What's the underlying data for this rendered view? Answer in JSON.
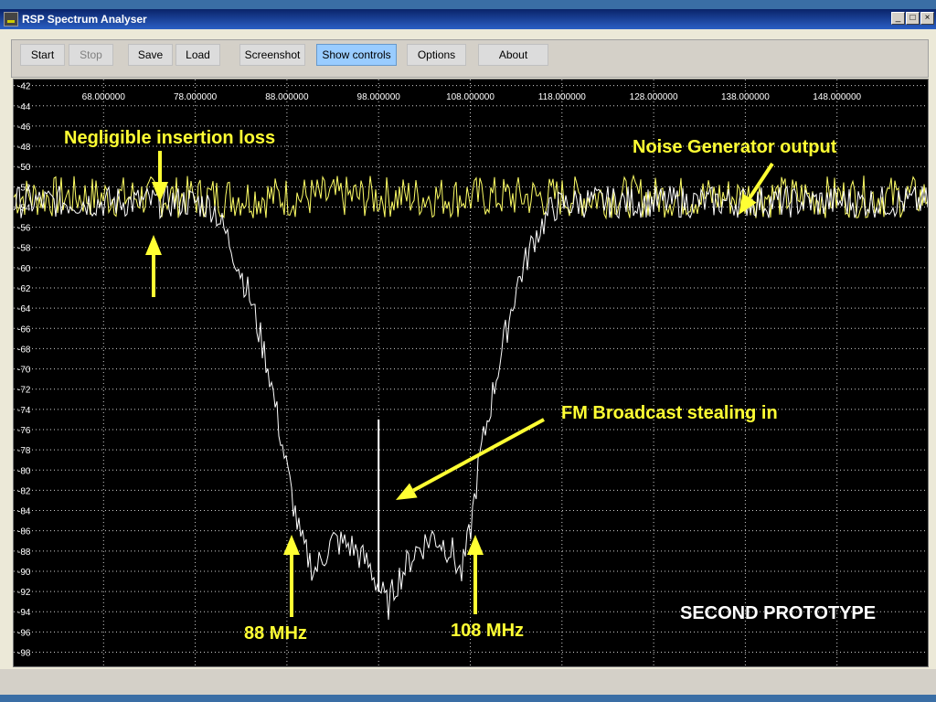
{
  "window": {
    "title": "RSP Spectrum Analyser",
    "controls": [
      "_",
      "□",
      "×"
    ]
  },
  "toolbar": {
    "buttons": [
      {
        "label": "Start",
        "state": "normal"
      },
      {
        "label": "Stop",
        "state": "disabled"
      },
      {
        "label": "Save",
        "state": "normal"
      },
      {
        "label": "Load",
        "state": "normal"
      },
      {
        "label": "Screenshot",
        "state": "normal"
      },
      {
        "label": "Show controls",
        "state": "active"
      },
      {
        "label": "Options",
        "state": "normal"
      },
      {
        "label": "About",
        "state": "normal"
      }
    ]
  },
  "chart_data": {
    "type": "line",
    "x_ticks": [
      "68.000000",
      "78.000000",
      "88.000000",
      "98.000000",
      "108.000000",
      "118.000000",
      "128.000000",
      "138.000000",
      "148.000000"
    ],
    "y_ticks": [
      "-42",
      "-44",
      "-46",
      "-48",
      "-50",
      "-52",
      "-54",
      "-56",
      "-58",
      "-60",
      "-62",
      "-64",
      "-66",
      "-68",
      "-70",
      "-72",
      "-74",
      "-76",
      "-78",
      "-80",
      "-82",
      "-84",
      "-86",
      "-88",
      "-90",
      "-92",
      "-94",
      "-96",
      "-98"
    ],
    "xlim": [
      58.2,
      157.9
    ],
    "ylim": [
      -99.4,
      -41.4
    ],
    "grid": true,
    "series": [
      {
        "color": "#ffff66",
        "level": -53,
        "range": [
          58.2,
          157.9
        ]
      },
      {
        "color": "#ffffff",
        "points": [
          [
            58.2,
            -53.5
          ],
          [
            68,
            -53.5
          ],
          [
            78,
            -53.5
          ],
          [
            80,
            -54
          ],
          [
            82,
            -58
          ],
          [
            84,
            -63
          ],
          [
            86,
            -70
          ],
          [
            88,
            -80
          ],
          [
            89.5,
            -87
          ],
          [
            91,
            -90
          ],
          [
            93,
            -87
          ],
          [
            95,
            -87.5
          ],
          [
            97,
            -89.5
          ],
          [
            98.5,
            -92.5
          ],
          [
            99,
            -93.5
          ],
          [
            100,
            -91
          ],
          [
            102,
            -88
          ],
          [
            104,
            -86.5
          ],
          [
            106,
            -88
          ],
          [
            107,
            -90.5
          ],
          [
            108,
            -86
          ],
          [
            109,
            -79
          ],
          [
            111,
            -70
          ],
          [
            113,
            -62
          ],
          [
            115,
            -57
          ],
          [
            117,
            -54
          ],
          [
            120,
            -53.5
          ],
          [
            157.9,
            -53.5
          ]
        ],
        "spike": {
          "x": 98,
          "y": -75
        }
      }
    ],
    "annotations": [
      {
        "text": "Negligible insertion loss"
      },
      {
        "text": "Noise Generator output"
      },
      {
        "text": "FM Broadcast stealing in"
      },
      {
        "text": "88 MHz"
      },
      {
        "text": "108 MHz"
      },
      {
        "text": "SECOND PROTOTYPE"
      }
    ],
    "annotation_color": "#ffff33"
  }
}
